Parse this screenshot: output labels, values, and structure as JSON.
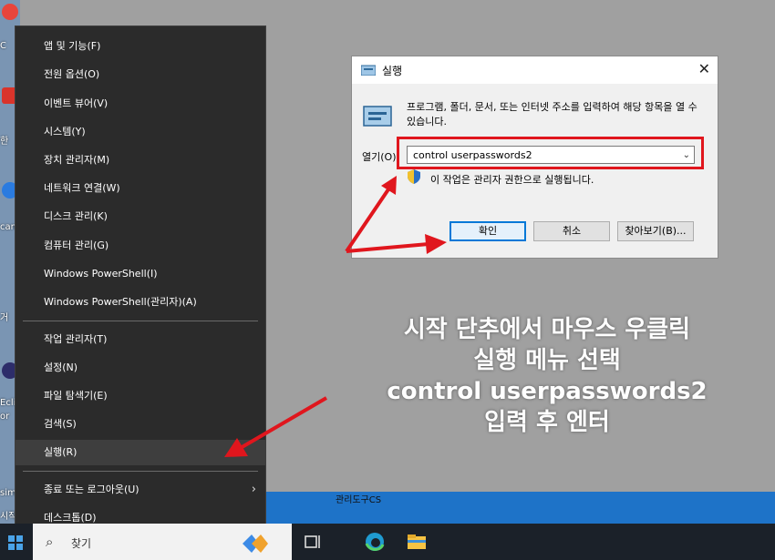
{
  "desktop": {
    "labels": [
      "C",
      "한",
      "can",
      "거",
      "Ecli",
      "or",
      "sim",
      "시작"
    ]
  },
  "background_band": {
    "text": "관리도구CS"
  },
  "context_menu": {
    "items": [
      "앱 및 기능(F)",
      "전원 옵션(O)",
      "이벤트 뷰어(V)",
      "시스템(Y)",
      "장치 관리자(M)",
      "네트워크 연결(W)",
      "디스크 관리(K)",
      "컴퓨터 관리(G)",
      "Windows PowerShell(I)",
      "Windows PowerShell(관리자)(A)",
      "작업 관리자(T)",
      "설정(N)",
      "파일 탐색기(E)",
      "검색(S)",
      "실행(R)",
      "종료 또는 로그아웃(U)",
      "데스크톱(D)"
    ],
    "selected": "실행(R)",
    "submenu_chevron": "›"
  },
  "run_dialog": {
    "title": "실행",
    "close": "✕",
    "description": "프로그램, 폴더, 문서, 또는 인터넷 주소를 입력하여 해당 항목을 열 수 있습니다.",
    "open_label": "열기(O):",
    "input_value": "control userpasswords2",
    "dropdown": "⌄",
    "admin_note": "이 작업은 관리자 권한으로 실행됩니다.",
    "buttons": {
      "ok": "확인",
      "cancel": "취소",
      "browse": "찾아보기(B)..."
    }
  },
  "instruction": {
    "line1": "시작 단추에서 마우스 우클릭",
    "line2": "실행 메뉴 선택",
    "line3": "control userpasswords2",
    "line4": "입력 후 엔터"
  },
  "taskbar": {
    "search_placeholder": "찾기",
    "search_icon": "⌕"
  },
  "colors": {
    "highlight": "#e0161d",
    "taskbar": "#1b2129",
    "menu_bg": "#2b2b2b"
  }
}
